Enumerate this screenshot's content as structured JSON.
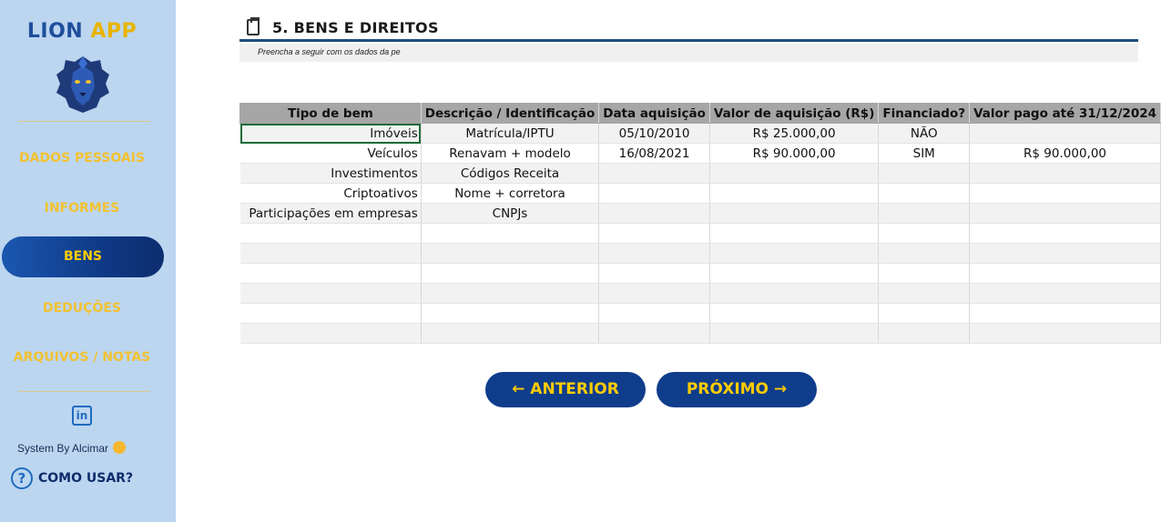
{
  "sidebar": {
    "app_title_part1": "LION",
    "app_title_part2": "APP",
    "logo_icon": "lion-head-icon",
    "items": [
      {
        "label": "DADOS PESSOAIS",
        "active": false
      },
      {
        "label": "INFORMES",
        "active": false
      },
      {
        "label": "BENS",
        "active": true
      },
      {
        "label": "DEDUÇÕES",
        "active": false
      },
      {
        "label": "ARQUIVOS / NOTAS",
        "active": false
      }
    ],
    "linkedin_icon": "linkedin-icon",
    "credit": "System By Alcimar",
    "help_label": "COMO USAR?"
  },
  "section": {
    "title": "5. BENS E DIREITOS",
    "subtitle": "Preencha a seguir com os dados da pe"
  },
  "table": {
    "headers": [
      "Tipo de bem",
      "Descrição / Identificação",
      "Data aquisição",
      "Valor de aquisição (R$)",
      "Financiado?",
      "Valor pago até 31/12/2024"
    ],
    "rows": [
      [
        "Imóveis",
        "Matrícula/IPTU",
        "05/10/2010",
        "R$ 25.000,00",
        "NÃO",
        ""
      ],
      [
        "Veículos",
        "Renavam + modelo",
        "16/08/2021",
        "R$ 90.000,00",
        "SIM",
        "R$ 90.000,00"
      ],
      [
        "Investimentos",
        "Códigos Receita",
        "",
        "",
        "",
        ""
      ],
      [
        "Criptoativos",
        "Nome + corretora",
        "",
        "",
        "",
        ""
      ],
      [
        "Participações em empresas",
        "CNPJs",
        "",
        "",
        "",
        ""
      ],
      [
        "",
        "",
        "",
        "",
        "",
        ""
      ],
      [
        "",
        "",
        "",
        "",
        "",
        ""
      ],
      [
        "",
        "",
        "",
        "",
        "",
        ""
      ],
      [
        "",
        "",
        "",
        "",
        "",
        ""
      ],
      [
        "",
        "",
        "",
        "",
        "",
        ""
      ],
      [
        "",
        "",
        "",
        "",
        "",
        ""
      ]
    ]
  },
  "buttons": {
    "prev_label": "← ANTERIOR",
    "next_label": "PRÓXIMO →"
  },
  "colors": {
    "sidebar_bg": "#bcd6f0",
    "accent": "#0f3d8c",
    "nav_text": "#f2c230"
  }
}
